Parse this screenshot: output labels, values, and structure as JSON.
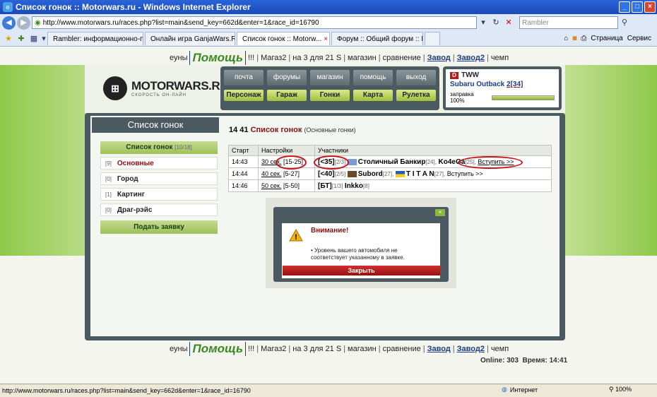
{
  "window": {
    "title": "Список гонок :: Motorwars.ru - Windows Internet Explorer"
  },
  "address": {
    "url": "http://www.motorwars.ru/races.php?list=main&send_key=662d&enter=1&race_id=16790",
    "search_placeholder": "Rambler"
  },
  "tabs": [
    {
      "label": "Rambler: информационно-п..."
    },
    {
      "label": "Онлайн игра GanjaWars.Ru ..."
    },
    {
      "label": "Список гонок :: Motorw..."
    },
    {
      "label": "Форум :: Общий форум :: М..."
    }
  ],
  "toolbar": {
    "page_label": "Страница",
    "service_label": "Сервис"
  },
  "sitenav": {
    "items": [
      "еуны",
      "Помощь",
      "!!!",
      "Магаз2",
      "на 3 для 21 S",
      "магазин",
      "сравнение",
      "Завод",
      "Завод2",
      "чемп"
    ]
  },
  "logo": {
    "name": "MOTORWARS.RU",
    "sub": "СКОРОСТЬ ОН-ЛАЙН"
  },
  "menu": {
    "top": [
      "почта",
      "форумы",
      "магазин",
      "помощь",
      "выход"
    ],
    "bottom": [
      "Персонаж",
      "Гараж",
      "Гонки",
      "Карта",
      "Рулетка"
    ]
  },
  "profile": {
    "clan": "TWW",
    "car": "Subaru Outback",
    "level": "2[34]",
    "fuel_label": "заправка 100%",
    "fuel_fraction": 1.0
  },
  "sidebar": {
    "title": "Список гонок",
    "head": "Список гонок",
    "head_count": "[10/18]",
    "items": [
      {
        "count": "[9]",
        "label": "Основные"
      },
      {
        "count": "[0]",
        "label": "Город"
      },
      {
        "count": "[1]",
        "label": "Картинг"
      },
      {
        "count": "[0]",
        "label": "Драг-рэйс"
      }
    ],
    "button": "Подать заявку"
  },
  "races": {
    "time": "14 41",
    "title": "Список гонок",
    "subtitle": "(Основные гонки)",
    "columns": [
      "Старт",
      "Настройки",
      "Участники"
    ],
    "rows": [
      {
        "start": "14:43",
        "dur": "30 сек.",
        "range": "[15-25]",
        "cls": "[<35]",
        "slots": "[2/3]",
        "p1": "Столичный Банкир",
        "p1l": "[24],",
        "p2": "Ko4eGa",
        "p2l": "[25],",
        "join": "Вступить >>"
      },
      {
        "start": "14:44",
        "dur": "40 сек.",
        "range": "[5-27]",
        "cls": "[<40]",
        "slots": "[2/5]",
        "p1": "Subord",
        "p1l": "[27],",
        "p2": "T I T A N",
        "p2l": "[27],",
        "join": "Вступить >>"
      },
      {
        "start": "14:46",
        "dur": "50 сек.",
        "range": "[5-50]",
        "cls": "[БТ]",
        "slots": "[1/3]",
        "p1": "Inkko",
        "p1l": "[8]",
        "p2": "",
        "p2l": "",
        "join": ""
      }
    ]
  },
  "dialog": {
    "title": "Внимание!",
    "message": "Уровень вашего автомобиля не соответствует указанному в заявке.",
    "button": "Закрыть"
  },
  "footer": {
    "online": "Online: 303",
    "time": "Время: 14:41"
  },
  "statusbar": {
    "url": "http://www.motorwars.ru/races.php?list=main&send_key=662d&enter=1&race_id=16790",
    "zone": "Интернет",
    "zoom": "100%"
  }
}
